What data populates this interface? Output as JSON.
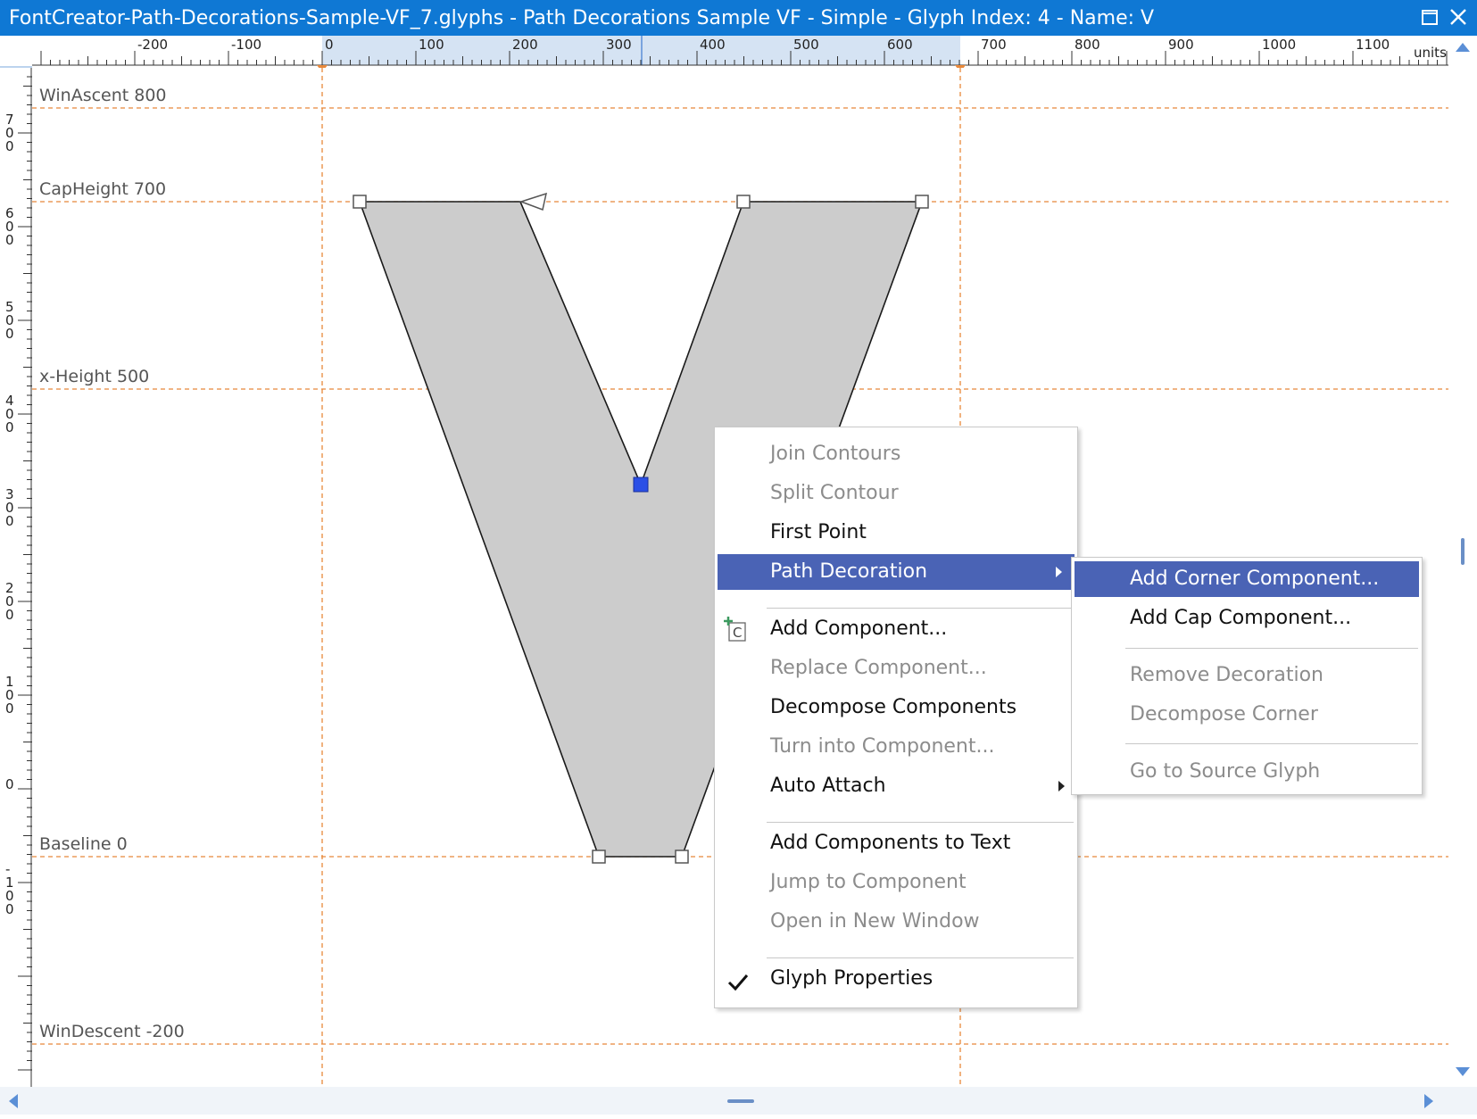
{
  "window": {
    "title": "FontCreator-Path-Decorations-Sample-VF_7.glyphs - Path Decorations Sample VF - Simple - Glyph Index: 4 - Name: V"
  },
  "ruler": {
    "units_label": "units",
    "h_labels": [
      "-200",
      "-100",
      "0",
      "100",
      "200",
      "300",
      "400",
      "500",
      "600",
      "700",
      "800",
      "900",
      "1000",
      "1100"
    ],
    "v_labels": [
      "7\n0\n0",
      "6\n0\n0",
      "5\n0\n0",
      "4\n0\n0",
      "3\n0\n0",
      "2\n0\n0",
      "1\n0\n0",
      "0",
      "-\n1\n0\n0"
    ]
  },
  "guides": {
    "win_ascent": "WinAscent 800",
    "cap_height": "CapHeight 700",
    "x_height": "x-Height 500",
    "baseline": "Baseline 0",
    "win_descent": "WinDescent -200"
  },
  "glyph": {
    "name": "V",
    "fill_color": "#cccccc",
    "selected_point_color": "#2b4fe6"
  },
  "colors": {
    "title_bar": "#0f78d4",
    "guide": "#e8883a",
    "menu_highlight": "#4a63b5"
  },
  "context_menu": {
    "join_contours": "Join Contours",
    "split_contour": "Split Contour",
    "first_point": "First Point",
    "path_decoration": "Path Decoration",
    "add_component": "Add Component...",
    "replace_component": "Replace Component...",
    "decompose_components": "Decompose Components",
    "turn_into_component": "Turn into Component...",
    "auto_attach": "Auto Attach",
    "add_components_to_text": "Add Components to Text",
    "jump_to_component": "Jump to Component",
    "open_in_new_window": "Open in New Window",
    "glyph_properties": "Glyph Properties"
  },
  "submenu": {
    "add_corner_component": "Add Corner Component...",
    "add_cap_component": "Add Cap Component...",
    "remove_decoration": "Remove Decoration",
    "decompose_corner": "Decompose Corner",
    "go_to_source_glyph": "Go to Source Glyph"
  }
}
